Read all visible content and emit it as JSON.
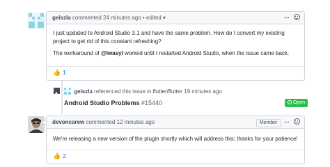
{
  "comment1": {
    "author": "geiszla",
    "time": "commented 24 minutes ago",
    "edited": "• edited ▾",
    "paragraph1": "I just updated to Android Studio 3.1 and have the same problem. How do I convert my existing project to get rid of this constant refreshing?",
    "paragraph2_prefix": "The workaround of ",
    "paragraph2_mention": "@lwasyl",
    "paragraph2_suffix": " worked until I restarted Android Studio, when the issue came back.",
    "reaction_count": "1"
  },
  "event": {
    "author": "geiszla",
    "text": "referenced this issue in",
    "repo": "flutter/flutter",
    "time": "19 minutes ago",
    "issue_title": "Android Studio Problems",
    "issue_number": "#15440",
    "status": "Open"
  },
  "comment2": {
    "author": "devoncarew",
    "time": "commented 12 minutes ago",
    "badge": "Member",
    "body": "We're releasing a new version of the plugin shortly which will address this; thanks for your patience!",
    "reaction_count": "2"
  },
  "icons": {
    "kebab": "kebab-menu-icon",
    "smile": "add-reaction-icon",
    "thumb": "thumbs-up-icon",
    "bookmark": "cross-reference-icon",
    "open": "issue-opened-icon"
  }
}
